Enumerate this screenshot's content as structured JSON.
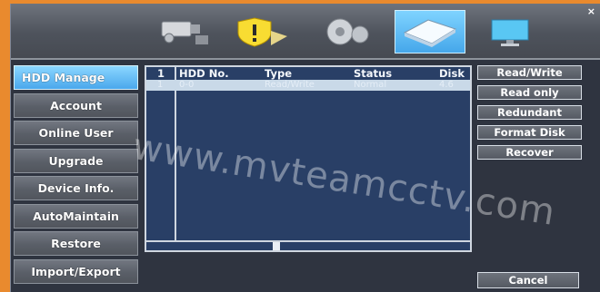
{
  "toolbar": {
    "close_glyph": "×",
    "tabs": [
      {
        "icon": "camera-icon"
      },
      {
        "icon": "alarm-shield-icon"
      },
      {
        "icon": "gear-icon"
      },
      {
        "icon": "hdd-icon"
      },
      {
        "icon": "monitor-icon"
      }
    ],
    "active_tab_index": 3
  },
  "sidebar": {
    "items": [
      {
        "label": "HDD Manage"
      },
      {
        "label": "Account"
      },
      {
        "label": "Online User"
      },
      {
        "label": "Upgrade"
      },
      {
        "label": "Device Info."
      },
      {
        "label": "AutoMaintain"
      },
      {
        "label": "Restore"
      },
      {
        "label": "Import/Export"
      }
    ],
    "active_index": 0
  },
  "table": {
    "columns": [
      "1",
      "HDD No.",
      "Type",
      "Status",
      "Disk"
    ],
    "rows": [
      [
        "1",
        "0-0",
        "Read/Write",
        "Normal",
        "4.6"
      ]
    ]
  },
  "actions": {
    "buttons": [
      "Read/Write",
      "Read only",
      "Redundant",
      "Format Disk",
      "Recover"
    ],
    "cancel_label": "Cancel"
  },
  "watermark": "www.mvteamcctv.com",
  "colors": {
    "frame": "#e98a2e",
    "panel": "#2f3440",
    "accent": "#45a7ea",
    "table_bg": "#293f66"
  }
}
